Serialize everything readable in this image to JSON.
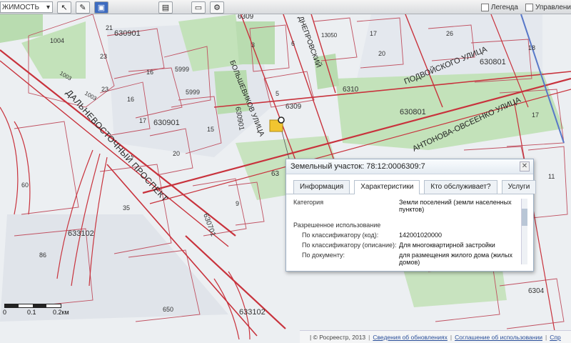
{
  "toolbar": {
    "mode_label": "ЖИМОСТЬ",
    "legend_label": "Легенда",
    "manage_label": "Управлени"
  },
  "map_labels": {
    "quarter_630901_top": "630901",
    "quarter_630901_mid": "630901",
    "quarter_630901_vert": "630901",
    "quarter_6309_top": "6309",
    "quarter_6309_mid": "6309",
    "quarter_6310": "6310",
    "quarter_630801_a": "630801",
    "quarter_630801_b": "630801",
    "quarter_633102_a": "633102",
    "quarter_633102_b": "633102",
    "quarter_630701": "630701",
    "quarter_6304": "6304",
    "quarter_63": "63",
    "parcel_1004": "1004",
    "parcel_1003a": "1003",
    "parcel_1003b": "1003",
    "parcel_21": "21",
    "parcel_23a": "23",
    "parcel_23b": "23",
    "parcel_16a": "16",
    "parcel_16b": "16",
    "parcel_17a": "17",
    "parcel_5999a": "5999",
    "parcel_5999b": "5999",
    "parcel_15": "15",
    "parcel_20": "20",
    "parcel_3": "3",
    "parcel_5": "5",
    "parcel_6": "6",
    "parcel_17b": "17",
    "parcel_20b": "20",
    "parcel_13050": "13050",
    "parcel_26": "26",
    "parcel_18": "18",
    "parcel_35": "35",
    "parcel_86": "86",
    "parcel_60": "60",
    "parcel_650": "650",
    "parcel_17c": "17",
    "parcel_11": "11",
    "parcel_9": "9",
    "street_dalnevostochny": "ДАЛЬНЕВОСТОЧНЫЙ ПРОСПЕКТ",
    "street_bolshevikov": "БОЛЬШЕВИКОВ УЛИЦА",
    "street_dneprovsky": "ДНЕПРОВСКИЙ",
    "street_podvoiskogo": "ПОДВОЙСКОГО УЛИЦА",
    "street_antonova": "АНТОНОВА-ОВСЕЕНКО УЛИЦА"
  },
  "popup": {
    "title": "Земельный участок: 78:12:0006309:7",
    "close_glyph": "✕",
    "tabs": [
      {
        "label": "Информация"
      },
      {
        "label": "Характеристики"
      },
      {
        "label": "Кто обслуживает?"
      },
      {
        "label": "Услуги"
      }
    ],
    "rows": {
      "category_label": "Категория",
      "category_value": "Земли поселений (земли населенных пунктов)",
      "permitted_use_label": "Разрешенное использование",
      "by_code_label": "По классификатору (код):",
      "by_code_value": "142001020000",
      "by_desc_label": "По классификатору (описание):",
      "by_desc_value": "Для многоквартирной застройки",
      "by_doc_label": "По документу:",
      "by_doc_value": "для размещения жилого дома (жилых домов)"
    }
  },
  "scale": {
    "zero": "0",
    "first": "0.1",
    "second": "0.2км"
  },
  "footer": {
    "copyright": "| © Росреестр, 2013",
    "link_updates": "Сведения об обновлениях",
    "link_terms": "Соглашение об использовании",
    "link_more": "Спр"
  },
  "colors": {
    "road_red": "#c8323c",
    "park_green": "#b9dcb0",
    "quarter_line": "#c05060",
    "highlight": "#f2c530",
    "background": "#eceff2"
  }
}
